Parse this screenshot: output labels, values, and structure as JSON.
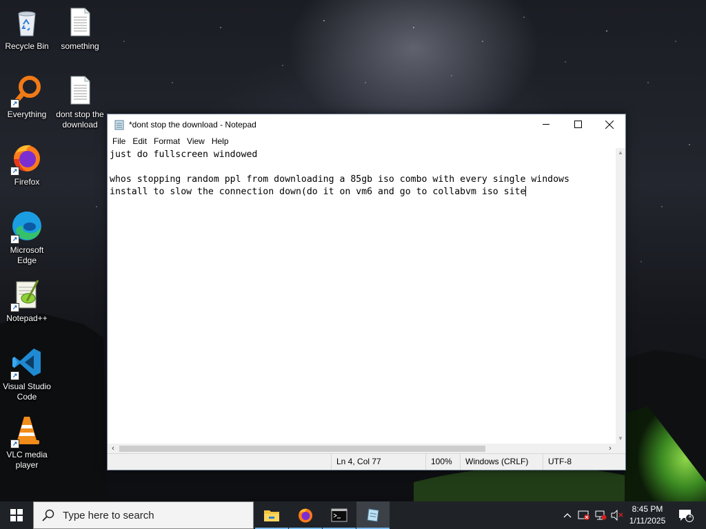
{
  "desktop": {
    "icons": [
      {
        "label": "Recycle Bin",
        "icon": "recycle-bin-icon"
      },
      {
        "label": "something",
        "icon": "text-file-icon"
      },
      {
        "label": "Everything",
        "icon": "everything-search-icon"
      },
      {
        "label": "dont stop the download",
        "icon": "text-file-icon"
      },
      {
        "label": "Firefox",
        "icon": "firefox-icon"
      },
      {
        "label": "Microsoft Edge",
        "icon": "edge-icon"
      },
      {
        "label": "Notepad++",
        "icon": "notepad-plus-plus-icon"
      },
      {
        "label": "Visual Studio Code",
        "icon": "vscode-icon"
      },
      {
        "label": "VLC media player",
        "icon": "vlc-icon"
      }
    ]
  },
  "notepad": {
    "title": "*dont stop the download - Notepad",
    "menu": [
      "File",
      "Edit",
      "Format",
      "View",
      "Help"
    ],
    "lines": [
      "just do fullscreen windowed",
      "",
      "whos stopping random ppl from downloading a 85gb iso combo with every single windows",
      "install to slow the connection down(do it on vm6 and go to collabvm iso site"
    ],
    "status": {
      "position": "Ln 4, Col 77",
      "zoom": "100%",
      "line_ending": "Windows (CRLF)",
      "encoding": "UTF-8"
    },
    "horizontal_scroll_fraction": 0
  },
  "taskbar": {
    "search_placeholder": "Type here to search",
    "time": "8:45 PM",
    "date": "1/11/2025",
    "notification_count": "1",
    "apps": [
      "file-explorer-icon",
      "firefox-icon",
      "terminal-icon",
      "notepad-icon"
    ]
  }
}
